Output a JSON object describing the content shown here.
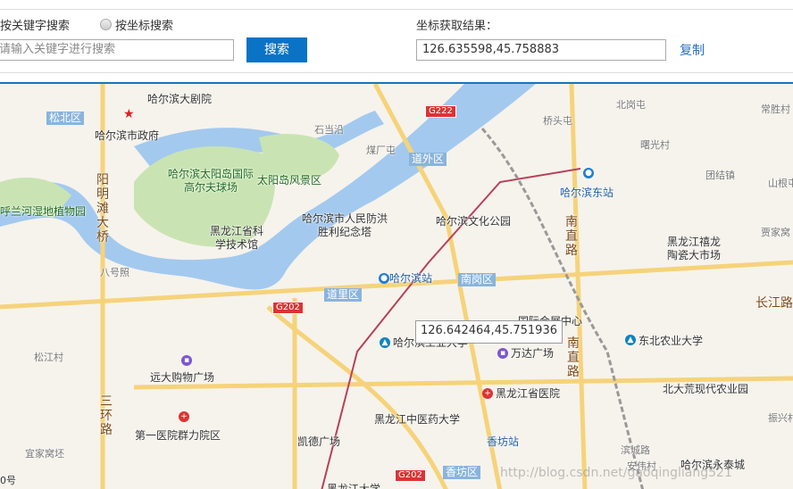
{
  "search": {
    "mode_keyword": "按关键字搜索",
    "mode_coord": "按坐标搜索",
    "placeholder": "请输入关键字进行搜索",
    "button": "搜索"
  },
  "result": {
    "label": "坐标获取结果：",
    "value": "126.635598,45.758883",
    "copy": "复制"
  },
  "map": {
    "tooltip": "126.642464,45.751936",
    "districts": [
      "松北区",
      "道外区",
      "道里区",
      "南岗区",
      "香坊区"
    ],
    "roads": [
      "G222",
      "G202",
      "G202"
    ],
    "labels": [
      "哈尔滨大剧院",
      "哈尔滨市政府",
      "哈尔滨太阳岛国际高尔夫球场",
      "太阳岛风景区",
      "呼兰河湿地植物园",
      "黑龙江省科学技术馆",
      "哈尔滨市人民防洪胜利纪念塔",
      "哈尔滨文化公园",
      "哈尔滨东站",
      "哈尔滨站",
      "国际会展中心",
      "哈尔滨工业大学",
      "万达广场",
      "东北农业大学",
      "黑龙江省医院",
      "黑龙江中医药大学",
      "香坊站",
      "远大购物广场",
      "第一医院群力院区",
      "凯德广场",
      "黑龙江禧龙陶瓷大市场",
      "北大荒现代农业园",
      "哈尔滨永泰城",
      "黑龙江大学"
    ],
    "roadnames": [
      "阳明滩大桥",
      "南直路",
      "南直路",
      "三环路",
      "长江路"
    ],
    "small": [
      "石当沿",
      "北岗屯",
      "常胜村",
      "桥头屯",
      "曙光村",
      "团结镇",
      "山根屯",
      "煤厂屯",
      "八号照",
      "贾家窝",
      "松江村",
      "宜家窝坯",
      "安伟村",
      "振兴村",
      "滨城路"
    ],
    "watermark": "http://blog.csdn.net/gaoqingliang521",
    "scale": "0号"
  }
}
